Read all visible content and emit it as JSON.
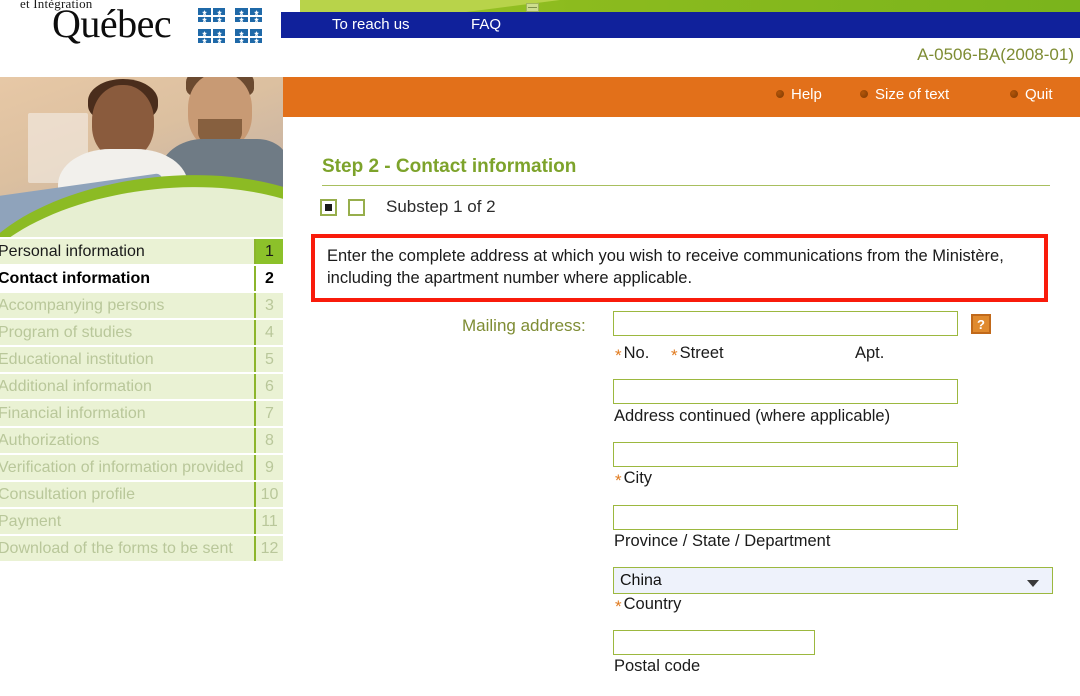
{
  "header": {
    "ministry_line": "et Intégration",
    "logo_word": "Québec",
    "form_code": "A-0506-BA(2008-01)",
    "nav": [
      {
        "label": "To reach us"
      },
      {
        "label": "FAQ"
      }
    ]
  },
  "toolbar": {
    "items": [
      {
        "label": "Help",
        "icon": "bullet-icon"
      },
      {
        "label": "Size of text",
        "icon": "bullet-icon"
      },
      {
        "label": "Quit",
        "icon": "bullet-icon"
      }
    ]
  },
  "sidebar": {
    "items": [
      {
        "label": "Personal information",
        "number": "1",
        "state": "done"
      },
      {
        "label": "Contact information",
        "number": "2",
        "state": "current"
      },
      {
        "label": "Accompanying persons",
        "number": "3",
        "state": "disabled"
      },
      {
        "label": "Program of studies",
        "number": "4",
        "state": "disabled"
      },
      {
        "label": "Educational institution",
        "number": "5",
        "state": "disabled"
      },
      {
        "label": "Additional information",
        "number": "6",
        "state": "disabled"
      },
      {
        "label": "Financial information",
        "number": "7",
        "state": "disabled"
      },
      {
        "label": "Authorizations",
        "number": "8",
        "state": "disabled"
      },
      {
        "label": "Verification of information provided",
        "number": "9",
        "state": "disabled"
      },
      {
        "label": "Consultation profile",
        "number": "10",
        "state": "disabled"
      },
      {
        "label": "Payment",
        "number": "11",
        "state": "disabled"
      },
      {
        "label": "Download of the forms to be sent",
        "number": "12",
        "state": "disabled"
      }
    ]
  },
  "main": {
    "step_title": "Step 2 - Contact information",
    "substep_text": "Substep 1 of 2",
    "substep_indicators": [
      {
        "state": "filled"
      },
      {
        "state": "empty"
      }
    ],
    "notice": "Enter the complete address at which you wish to receive communications from the Ministère, including the apartment number where applicable.",
    "fields": {
      "mailing_address": {
        "label": "Mailing address:",
        "value": "",
        "help_icon": "question-mark-icon",
        "help_label": "?",
        "sub_labels": {
          "no": "No.",
          "no_required": "*",
          "street": "Street",
          "street_required": "*",
          "apt": "Apt."
        }
      },
      "address_continued": {
        "label": "Address continued (where applicable)",
        "value": ""
      },
      "city": {
        "label": "City",
        "required_mark": "*",
        "value": ""
      },
      "province": {
        "label": "Province / State / Department",
        "value": ""
      },
      "country": {
        "label": "Country",
        "required_mark": "*",
        "value": "China",
        "options": [
          "China"
        ]
      },
      "postal_code": {
        "label": "Postal code",
        "value": ""
      }
    }
  },
  "colors": {
    "brand_blue": "#10219b",
    "brand_green": "#8cc12a",
    "olive_text": "#7e8c33",
    "orange_bar": "#e2701a",
    "notice_border": "#f91b0b",
    "sidebar_bg": "#eaf2d4",
    "field_border": "#9cb83f"
  }
}
